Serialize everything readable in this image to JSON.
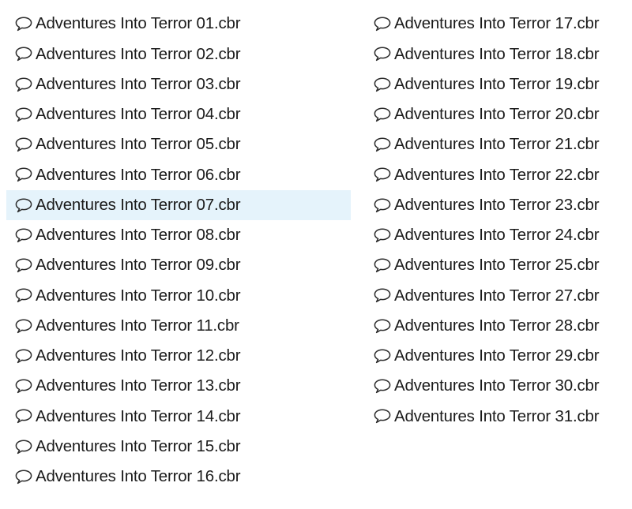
{
  "icon": "speech-bubble-icon",
  "selection_color": "#e5f3fb",
  "selected_file": "Adventures Into Terror 07.cbr",
  "columns": [
    {
      "files": [
        "Adventures Into Terror 01.cbr",
        "Adventures Into Terror 02.cbr",
        "Adventures Into Terror 03.cbr",
        "Adventures Into Terror 04.cbr",
        "Adventures Into Terror 05.cbr",
        "Adventures Into Terror 06.cbr",
        "Adventures Into Terror 07.cbr",
        "Adventures Into Terror 08.cbr",
        "Adventures Into Terror 09.cbr",
        "Adventures Into Terror 10.cbr",
        "Adventures Into Terror 11.cbr",
        "Adventures Into Terror 12.cbr",
        "Adventures Into Terror 13.cbr",
        "Adventures Into Terror 14.cbr",
        "Adventures Into Terror 15.cbr",
        "Adventures Into Terror 16.cbr"
      ]
    },
    {
      "files": [
        "Adventures Into Terror 17.cbr",
        "Adventures Into Terror 18.cbr",
        "Adventures Into Terror 19.cbr",
        "Adventures Into Terror 20.cbr",
        "Adventures Into Terror 21.cbr",
        "Adventures Into Terror 22.cbr",
        "Adventures Into Terror 23.cbr",
        "Adventures Into Terror 24.cbr",
        "Adventures Into Terror 25.cbr",
        "Adventures Into Terror 27.cbr",
        "Adventures Into Terror 28.cbr",
        "Adventures Into Terror 29.cbr",
        "Adventures Into Terror 30.cbr",
        "Adventures Into Terror 31.cbr"
      ]
    }
  ]
}
